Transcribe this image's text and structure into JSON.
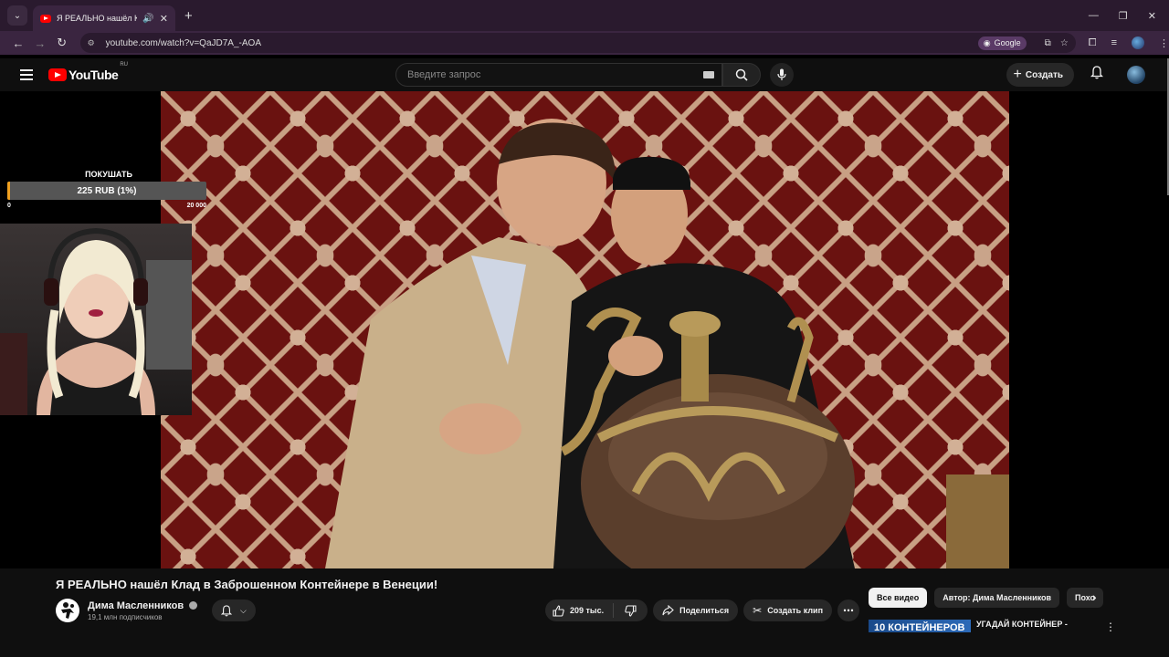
{
  "browser": {
    "tab_title": "Я РЕАЛЬНО нашёл Клад в",
    "url": "youtube.com/watch?v=QaJD7A_-AOA",
    "google_chip": "Google"
  },
  "youtube": {
    "logo_text": "YouTube",
    "region": "RU",
    "search_placeholder": "Введите запрос",
    "create_label": "Создать"
  },
  "overlay": {
    "donation_label": "ПОКУШАТЬ",
    "donation_progress": "225 RUB (1%)",
    "donation_fraction": 0.01,
    "range_min": "0",
    "range_max": "20 000"
  },
  "video": {
    "title": "Я РЕАЛЬНО нашёл Клад в Заброшенном Контейнере в Венеции!",
    "channel_name": "Дима Масленников",
    "subscribers": "19,1 млн подписчиков",
    "likes": "209 тыс.",
    "share_label": "Поделиться",
    "clip_label": "Создать клип"
  },
  "sidebar": {
    "chips": [
      "Все видео",
      "Автор: Дима Масленников",
      "Похо"
    ],
    "rec_thumb_text": "10 КОНТЕЙНЕРОВ",
    "rec_title": "УГАДАЙ КОНТЕЙНЕР -"
  },
  "colors": {
    "brand_red": "#ff0000",
    "donation_fill": "#f0a020",
    "browser_frame": "#3a2540"
  }
}
